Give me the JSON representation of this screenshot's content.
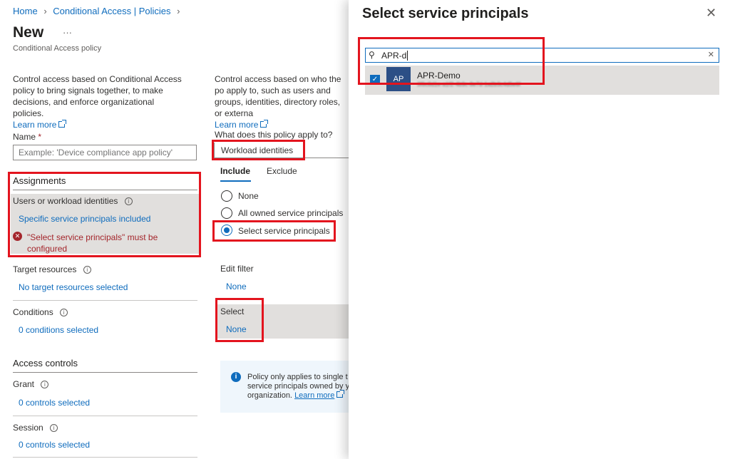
{
  "breadcrumb": {
    "home": "Home",
    "section": "Conditional Access | Policies"
  },
  "page": {
    "title": "New",
    "more": "···",
    "subtitle": "Conditional Access policy"
  },
  "left": {
    "description": "Control access based on Conditional Access policy to bring signals together, to make decisions, and enforce organizational policies.",
    "learn_more": "Learn more",
    "name_label": "Name",
    "required_mark": "*",
    "name_placeholder": "Example: 'Device compliance app policy'",
    "assignments_heading": "Assignments",
    "users_label": "Users or workload identities",
    "users_value": "Specific service principals included",
    "error_text": "\"Select service principals\" must be configured",
    "target_label": "Target resources",
    "target_value": "No target resources selected",
    "conditions_label": "Conditions",
    "conditions_value": "0 conditions selected",
    "access_controls_heading": "Access controls",
    "grant_label": "Grant",
    "grant_value": "0 controls selected",
    "session_label": "Session",
    "session_value": "0 controls selected"
  },
  "middle": {
    "description": "Control access based on who the po apply to, such as users and groups, identities, directory roles, or externa",
    "learn_more": "Learn more",
    "applies_label": "What does this policy apply to?",
    "applies_value": "Workload identities",
    "tabs": [
      "Include",
      "Exclude"
    ],
    "radios": [
      "None",
      "All owned service principals",
      "Select service principals"
    ],
    "edit_filter_label": "Edit filter",
    "edit_filter_value": "None",
    "select_label": "Select",
    "select_value": "None",
    "info_text": "Policy only applies to single t service principals owned by y organization.",
    "info_link": "Learn more"
  },
  "panel": {
    "title": "Select service principals",
    "search_value": "APR-d",
    "result": {
      "avatar": "AP",
      "name": "APR-Demo",
      "id": "3f6c8d1e-a1f2-4b9c-8e7d-1a2b3c4d5e6f"
    }
  },
  "colors": {
    "accent": "#0f6cbd",
    "error": "#a4262c",
    "highlight": "#e3141e",
    "avatar_bg": "#2c4f86"
  }
}
